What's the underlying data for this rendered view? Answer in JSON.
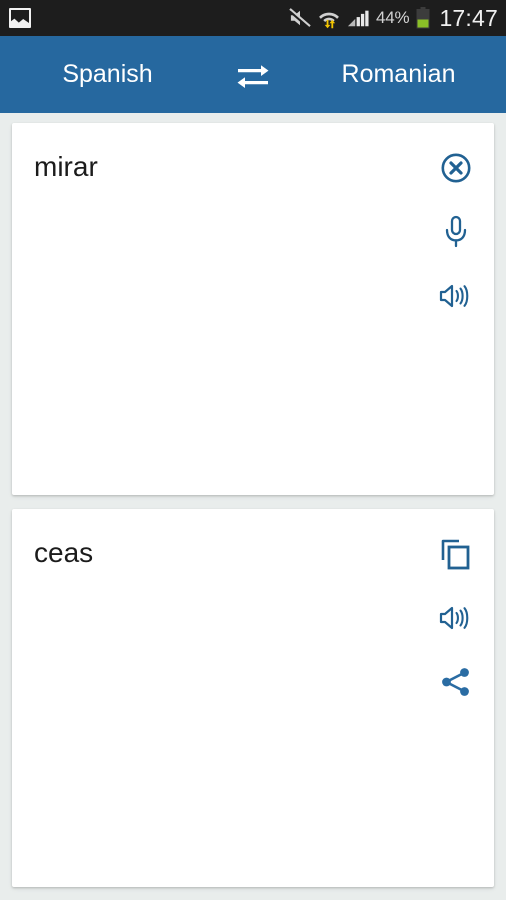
{
  "status_bar": {
    "notification_icon": "gallery-image-icon",
    "mute_icon": "volume-mute-icon",
    "wifi_icon": "wifi-transfer-icon",
    "signal_icon": "cellular-signal-icon",
    "battery_percent": "44%",
    "battery_icon": "battery-icon",
    "clock": "17:47",
    "battery_fill_color": "#8bc027",
    "background": "#1d1d1d"
  },
  "header": {
    "source_language": "Spanish",
    "target_language": "Romanian",
    "swap_icon": "swap-horizontal-icon",
    "background": "#26689f",
    "text_color": "#ffffff"
  },
  "source_card": {
    "text": "mirar",
    "actions": [
      {
        "name": "clear-button",
        "icon": "close-circle-icon"
      },
      {
        "name": "voice-input-button",
        "icon": "microphone-icon"
      },
      {
        "name": "speak-source-button",
        "icon": "speaker-icon"
      }
    ]
  },
  "target_card": {
    "text": "ceas",
    "actions": [
      {
        "name": "copy-button",
        "icon": "copy-icon"
      },
      {
        "name": "speak-target-button",
        "icon": "speaker-icon"
      },
      {
        "name": "share-button",
        "icon": "share-icon"
      }
    ]
  },
  "theme": {
    "page_background": "#e9edec",
    "card_background": "#ffffff",
    "icon_blue": "#216192",
    "text_color": "#1b1b1b"
  }
}
